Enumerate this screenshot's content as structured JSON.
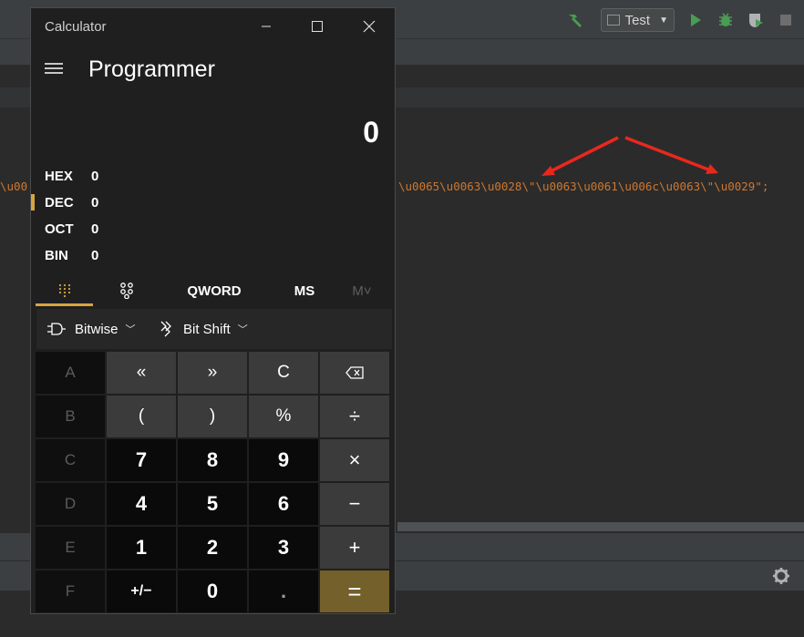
{
  "ide": {
    "run_config": "Test",
    "code_left": "\\u00",
    "code_right": "\\u0065\\u0063\\u0028\\\"\\u0063\\u0061\\u006c\\u0063\\\"\\u0029\";",
    "accent_red": "#e8281e",
    "string_color": "#cc7832",
    "icons": [
      "build-hammer-icon",
      "run-icon",
      "debug-icon",
      "coverage-icon",
      "stop-icon",
      "gear-icon"
    ]
  },
  "calculator": {
    "window_title": "Calculator",
    "mode_title": "Programmer",
    "display_value": "0",
    "radix": [
      {
        "label": "HEX",
        "value": "0"
      },
      {
        "label": "DEC",
        "value": "0"
      },
      {
        "label": "OCT",
        "value": "0"
      },
      {
        "label": "BIN",
        "value": "0"
      }
    ],
    "selected_radix": "DEC",
    "tabs": {
      "word_size": "QWORD",
      "memory_store": "MS",
      "memory_recall": "M˅"
    },
    "ops": {
      "bitwise": "Bitwise",
      "bitshift": "Bit Shift"
    },
    "keys": [
      [
        "A",
        "«",
        "»",
        "C",
        "⌫"
      ],
      [
        "B",
        "(",
        ")",
        "%",
        "÷"
      ],
      [
        "C",
        "7",
        "8",
        "9",
        "×"
      ],
      [
        "D",
        "4",
        "5",
        "6",
        "−"
      ],
      [
        "E",
        "1",
        "2",
        "3",
        "+"
      ],
      [
        "F",
        "+/−",
        "0",
        ".",
        "="
      ]
    ],
    "accent_color": "#d6a541",
    "equals_color": "#73602a"
  }
}
